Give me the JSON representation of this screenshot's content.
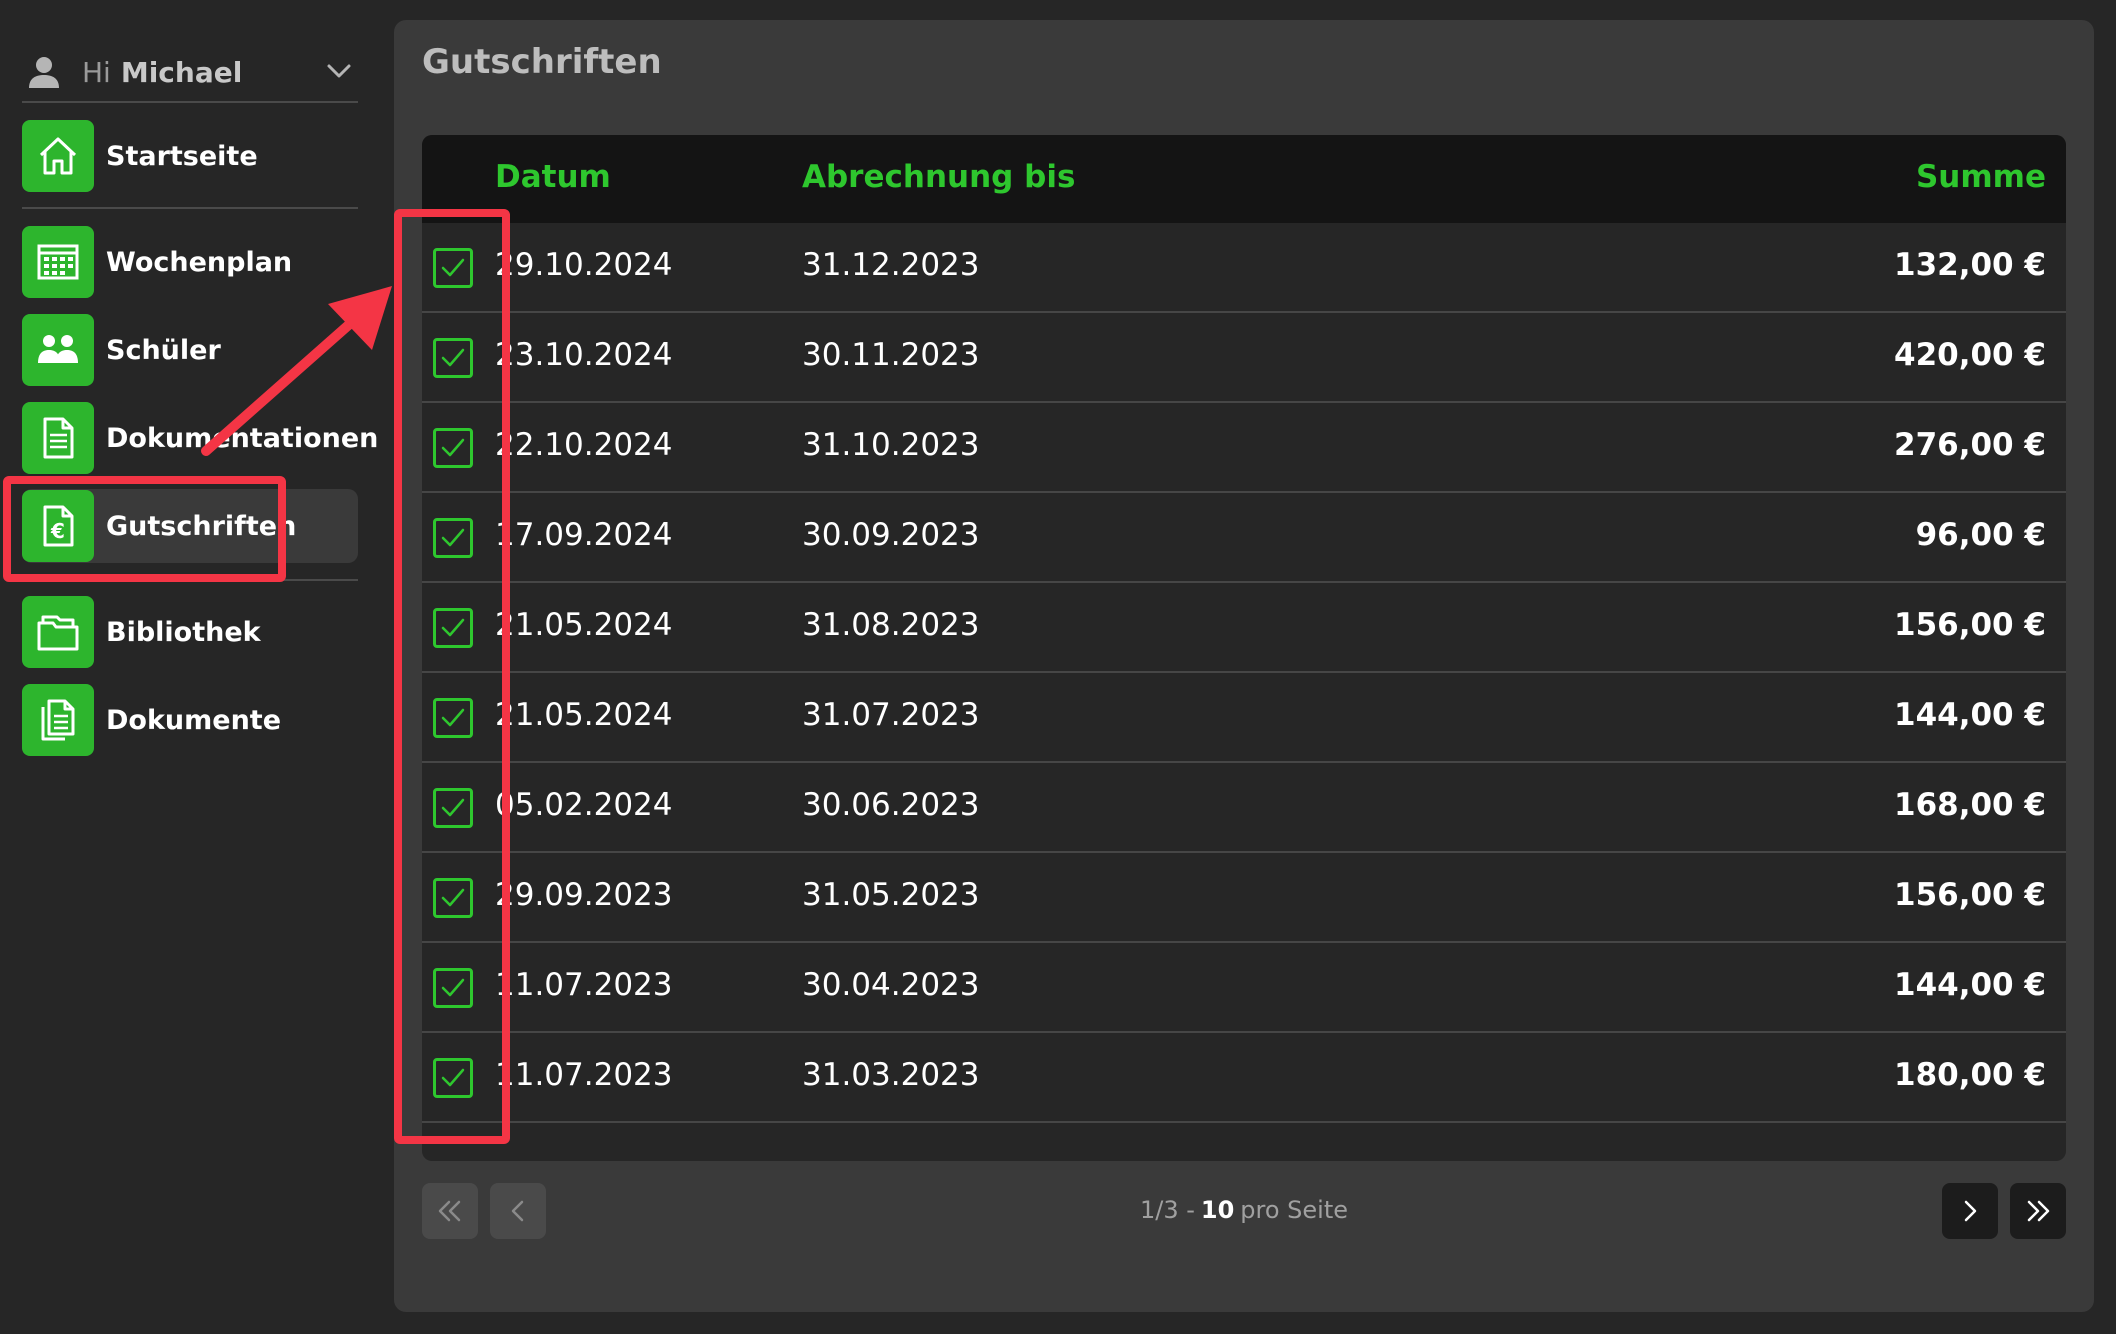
{
  "user": {
    "greeting": "Hi",
    "name": "Michael"
  },
  "nav": [
    {
      "label": "Startseite",
      "icon": "home-icon"
    },
    {
      "label": "Wochenplan",
      "icon": "calendar-grid-icon"
    },
    {
      "label": "Schüler",
      "icon": "students-icon"
    },
    {
      "label": "Dokumentationen",
      "icon": "documentation-icon"
    },
    {
      "label": "Gutschriften",
      "icon": "euro-document-icon",
      "active": true
    },
    {
      "label": "Bibliothek",
      "icon": "folder-icon"
    },
    {
      "label": "Dokumente",
      "icon": "documents-icon"
    }
  ],
  "page": {
    "title": "Gutschriften"
  },
  "table": {
    "headers": {
      "datum": "Datum",
      "abrechnung": "Abrechnung bis",
      "summe": "Summe"
    },
    "rows": [
      {
        "datum": "29.10.2024",
        "abrechnung": "31.12.2023",
        "summe": "132,00 €",
        "checked": true
      },
      {
        "datum": "23.10.2024",
        "abrechnung": "30.11.2023",
        "summe": "420,00 €",
        "checked": true
      },
      {
        "datum": "22.10.2024",
        "abrechnung": "31.10.2023",
        "summe": "276,00 €",
        "checked": true
      },
      {
        "datum": "17.09.2024",
        "abrechnung": "30.09.2023",
        "summe": "96,00 €",
        "checked": true
      },
      {
        "datum": "21.05.2024",
        "abrechnung": "31.08.2023",
        "summe": "156,00 €",
        "checked": true
      },
      {
        "datum": "21.05.2024",
        "abrechnung": "31.07.2023",
        "summe": "144,00 €",
        "checked": true
      },
      {
        "datum": "05.02.2024",
        "abrechnung": "30.06.2023",
        "summe": "168,00 €",
        "checked": true
      },
      {
        "datum": "29.09.2023",
        "abrechnung": "31.05.2023",
        "summe": "156,00 €",
        "checked": true
      },
      {
        "datum": "11.07.2023",
        "abrechnung": "30.04.2023",
        "summe": "144,00 €",
        "checked": true
      },
      {
        "datum": "11.07.2023",
        "abrechnung": "31.03.2023",
        "summe": "180,00 €",
        "checked": true
      }
    ]
  },
  "pagination": {
    "page": "1/3 -",
    "per_page": "10",
    "per_page_label": "pro Seite"
  },
  "colors": {
    "accent": "#2ec72e",
    "highlight": "#f43545",
    "background": "#262626",
    "panel": "#3a3a3a"
  }
}
